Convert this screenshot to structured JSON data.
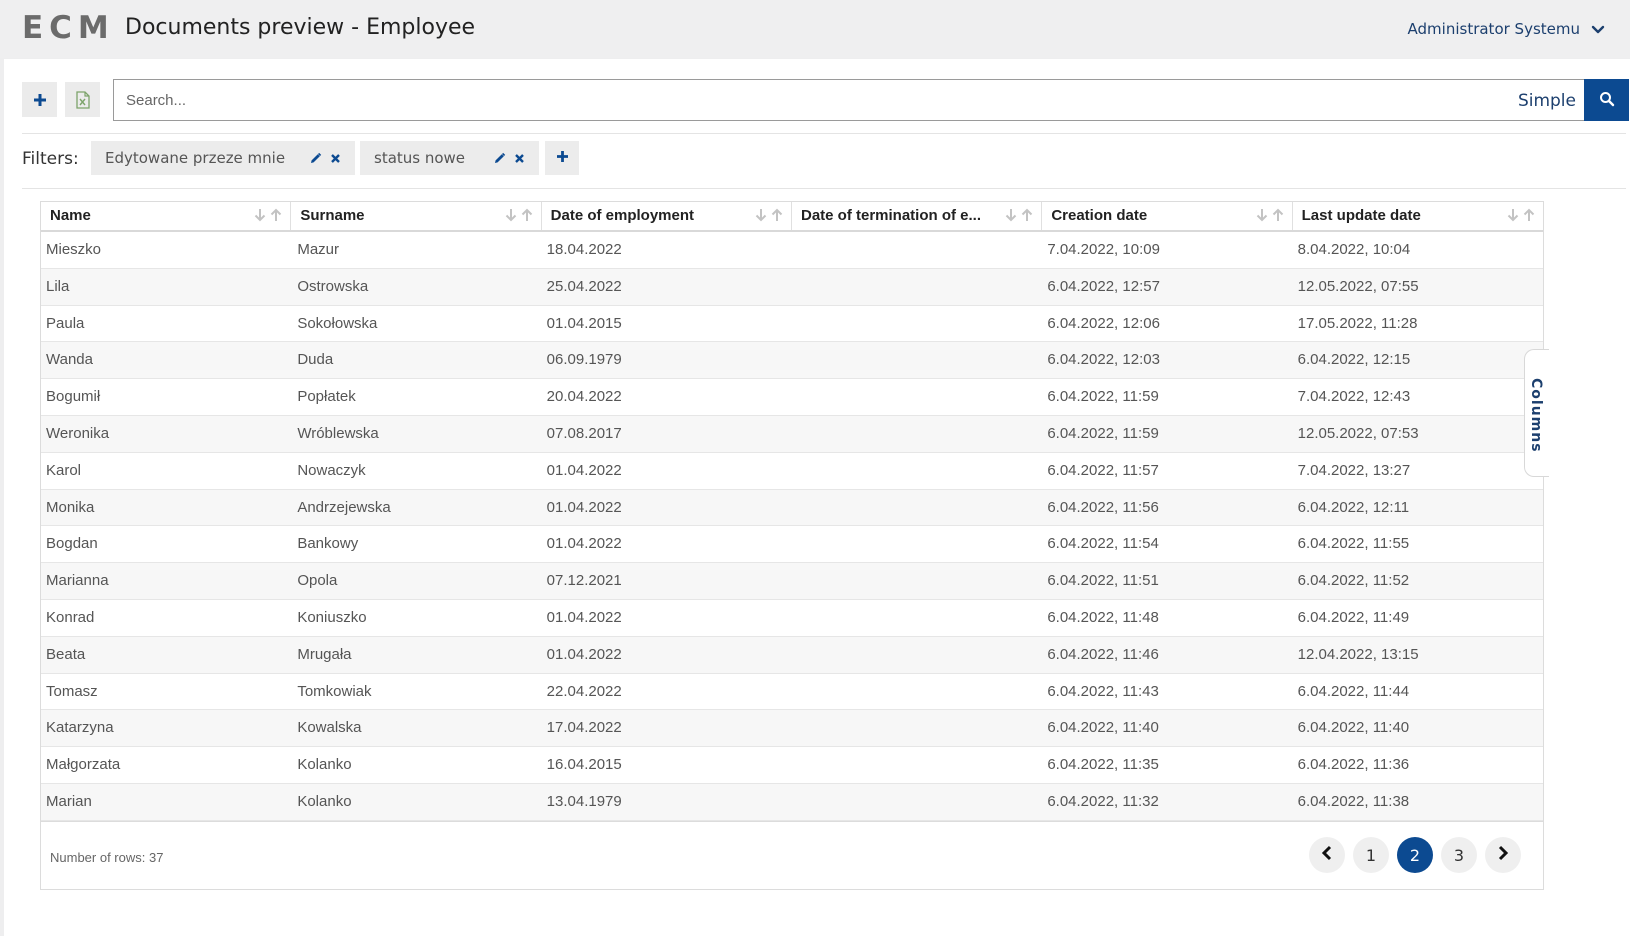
{
  "header": {
    "logo": "ECM",
    "title": "Documents preview - Employee",
    "user": "Administrator Systemu"
  },
  "search": {
    "placeholder": "Search...",
    "value": "",
    "mode": "Simple"
  },
  "filters": {
    "label": "Filters:",
    "items": [
      {
        "label": "Edytowane przeze mnie"
      },
      {
        "label": "status nowe"
      }
    ]
  },
  "table": {
    "columns": [
      "Name",
      "Surname",
      "Date of employment",
      "Date of termination of e...",
      "Creation date",
      "Last update date"
    ],
    "rows": [
      [
        "Mieszko",
        "Mazur",
        "18.04.2022",
        "",
        "7.04.2022, 10:09",
        "8.04.2022, 10:04"
      ],
      [
        "Lila",
        "Ostrowska",
        "25.04.2022",
        "",
        "6.04.2022, 12:57",
        "12.05.2022, 07:55"
      ],
      [
        "Paula",
        "Sokołowska",
        "01.04.2015",
        "",
        "6.04.2022, 12:06",
        "17.05.2022, 11:28"
      ],
      [
        "Wanda",
        "Duda",
        "06.09.1979",
        "",
        "6.04.2022, 12:03",
        "6.04.2022, 12:15"
      ],
      [
        "Bogumił",
        "Popłatek",
        "20.04.2022",
        "",
        "6.04.2022, 11:59",
        "7.04.2022, 12:43"
      ],
      [
        "Weronika",
        "Wróblewska",
        "07.08.2017",
        "",
        "6.04.2022, 11:59",
        "12.05.2022, 07:53"
      ],
      [
        "Karol",
        "Nowaczyk",
        "01.04.2022",
        "",
        "6.04.2022, 11:57",
        "7.04.2022, 13:27"
      ],
      [
        "Monika",
        "Andrzejewska",
        "01.04.2022",
        "",
        "6.04.2022, 11:56",
        "6.04.2022, 12:11"
      ],
      [
        "Bogdan",
        "Bankowy",
        "01.04.2022",
        "",
        "6.04.2022, 11:54",
        "6.04.2022, 11:55"
      ],
      [
        "Marianna",
        "Opola",
        "07.12.2021",
        "",
        "6.04.2022, 11:51",
        "6.04.2022, 11:52"
      ],
      [
        "Konrad",
        "Koniuszko",
        "01.04.2022",
        "",
        "6.04.2022, 11:48",
        "6.04.2022, 11:49"
      ],
      [
        "Beata",
        "Mrugała",
        "01.04.2022",
        "",
        "6.04.2022, 11:46",
        "12.04.2022, 13:15"
      ],
      [
        "Tomasz",
        "Tomkowiak",
        "22.04.2022",
        "",
        "6.04.2022, 11:43",
        "6.04.2022, 11:44"
      ],
      [
        "Katarzyna",
        "Kowalska",
        "17.04.2022",
        "",
        "6.04.2022, 11:40",
        "6.04.2022, 11:40"
      ],
      [
        "Małgorzata",
        "Kolanko",
        "16.04.2015",
        "",
        "6.04.2022, 11:35",
        "6.04.2022, 11:36"
      ],
      [
        "Marian",
        "Kolanko",
        "13.04.1979",
        "",
        "6.04.2022, 11:32",
        "6.04.2022, 11:38"
      ]
    ],
    "columns_tab": "Columns",
    "row_count_text": "Number of rows: 37"
  },
  "pagination": {
    "pages": [
      "1",
      "2",
      "3"
    ],
    "current": "2"
  },
  "colors": {
    "accent": "#0c4a91",
    "brand_text": "#1c3f6e",
    "logo": "#6b6b6b"
  },
  "icons": {
    "add": "plus-icon",
    "export": "excel-file-icon",
    "search": "search-icon",
    "user_menu": "chevron-down-icon",
    "filter_edit": "pencil-icon",
    "filter_remove": "close-icon",
    "sort_desc": "arrow-down-icon",
    "sort_asc": "arrow-up-icon",
    "prev": "chevron-left-icon",
    "next": "chevron-right-icon"
  }
}
